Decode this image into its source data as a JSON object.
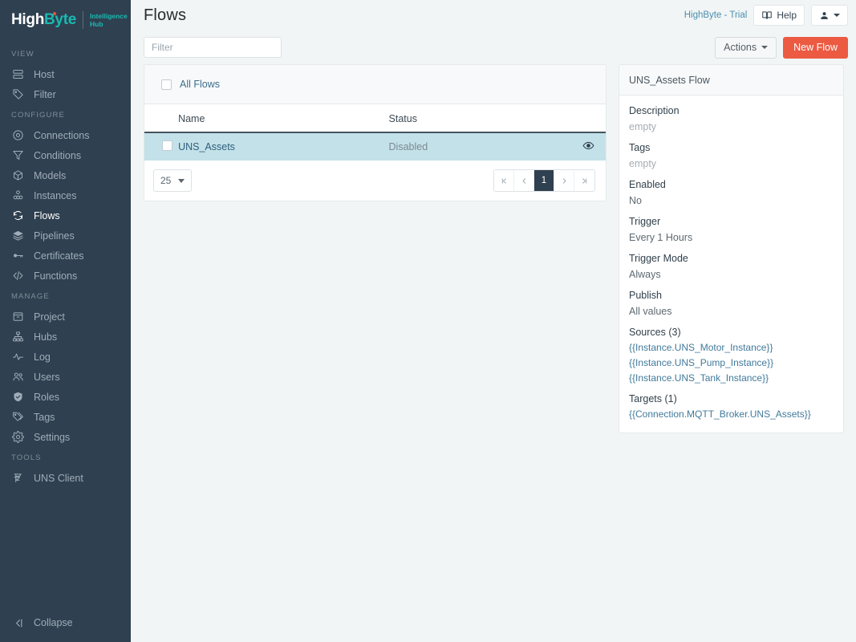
{
  "brand": {
    "name_part1": "High",
    "name_part2": "Byte",
    "sub_line1": "Intelligence",
    "sub_line2": "Hub"
  },
  "sidebar": {
    "sections": [
      {
        "label": "VIEW",
        "items": [
          {
            "label": "Host",
            "icon": "server-icon",
            "active": false
          },
          {
            "label": "Filter",
            "icon": "tag-icon",
            "active": false
          }
        ]
      },
      {
        "label": "CONFIGURE",
        "items": [
          {
            "label": "Connections",
            "icon": "connections-icon",
            "active": false
          },
          {
            "label": "Conditions",
            "icon": "funnel-icon",
            "active": false
          },
          {
            "label": "Models",
            "icon": "cube-icon",
            "active": false
          },
          {
            "label": "Instances",
            "icon": "instances-icon",
            "active": false
          },
          {
            "label": "Flows",
            "icon": "refresh-icon",
            "active": true
          },
          {
            "label": "Pipelines",
            "icon": "layers-icon",
            "active": false
          },
          {
            "label": "Certificates",
            "icon": "key-icon",
            "active": false
          },
          {
            "label": "Functions",
            "icon": "code-icon",
            "active": false
          }
        ]
      },
      {
        "label": "MANAGE",
        "items": [
          {
            "label": "Project",
            "icon": "archive-icon",
            "active": false
          },
          {
            "label": "Hubs",
            "icon": "hubs-icon",
            "active": false
          },
          {
            "label": "Log",
            "icon": "activity-icon",
            "active": false
          },
          {
            "label": "Users",
            "icon": "users-icon",
            "active": false
          },
          {
            "label": "Roles",
            "icon": "shield-icon",
            "active": false
          },
          {
            "label": "Tags",
            "icon": "tags-icon",
            "active": false
          },
          {
            "label": "Settings",
            "icon": "gear-icon",
            "active": false
          }
        ]
      },
      {
        "label": "TOOLS",
        "items": [
          {
            "label": "UNS Client",
            "icon": "uns-client-icon",
            "active": false
          }
        ]
      }
    ],
    "collapse_label": "Collapse"
  },
  "header": {
    "title": "Flows",
    "license": "HighByte - Trial",
    "help_label": "Help"
  },
  "toolbar": {
    "filter_placeholder": "Filter",
    "filter_value": "",
    "actions_label": "Actions",
    "new_flow_label": "New Flow"
  },
  "table": {
    "select_all_label": "All Flows",
    "columns": [
      "Name",
      "Status"
    ],
    "rows": [
      {
        "name": "UNS_Assets",
        "status": "Disabled",
        "selected": true
      }
    ]
  },
  "pagination": {
    "page_size": "25",
    "first_label": "⏮",
    "prev_label": "‹",
    "current_page": "1",
    "next_label": "›",
    "last_label": "⏭"
  },
  "detail": {
    "title": "UNS_Assets Flow",
    "fields": [
      {
        "label": "Description",
        "value": "empty",
        "empty": true
      },
      {
        "label": "Tags",
        "value": "empty",
        "empty": true
      },
      {
        "label": "Enabled",
        "value": "No",
        "empty": false
      },
      {
        "label": "Trigger",
        "value": "Every 1 Hours",
        "empty": false
      },
      {
        "label": "Trigger Mode",
        "value": "Always",
        "empty": false
      },
      {
        "label": "Publish",
        "value": "All values",
        "empty": false
      }
    ],
    "sources_label": "Sources (3)",
    "sources": [
      "{{Instance.UNS_Motor_Instance}}",
      "{{Instance.UNS_Pump_Instance}}",
      "{{Instance.UNS_Tank_Instance}}"
    ],
    "targets_label": "Targets (1)",
    "targets": [
      "{{Connection.MQTT_Broker.UNS_Assets}}"
    ]
  },
  "colors": {
    "sidebar_bg": "#2f4050",
    "accent_teal": "#1ab9b0",
    "primary_orange": "#ec5a42",
    "row_selected": "#c3e1e8",
    "page_bg": "#f1f5f6",
    "link_blue": "#3c6e8c"
  }
}
